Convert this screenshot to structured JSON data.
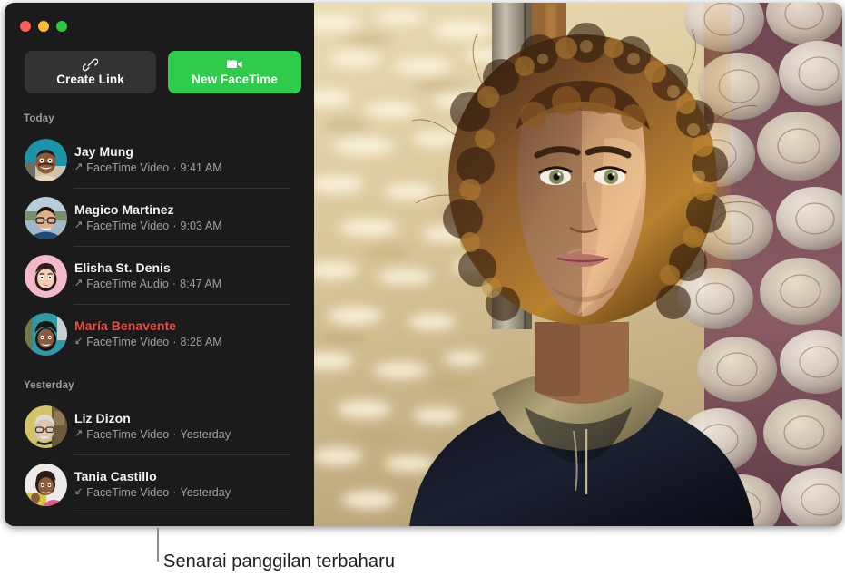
{
  "window": {
    "traffic_lights": [
      {
        "name": "close",
        "color": "#ff5f57"
      },
      {
        "name": "minimize",
        "color": "#febc2e"
      },
      {
        "name": "zoom",
        "color": "#28c840"
      }
    ]
  },
  "toolbar": {
    "create_link": {
      "label": "Create Link",
      "icon": "link-icon"
    },
    "new_facetime": {
      "label": "New FaceTime",
      "icon": "video-camera-icon",
      "color": "#2ecc4a"
    }
  },
  "sections": [
    {
      "title": "Today",
      "rows": [
        {
          "name": "Jay Mung",
          "direction": "outgoing",
          "arrow": "↗",
          "kind": "FaceTime Video",
          "separator": "·",
          "time": "9:41 AM",
          "missed": false,
          "avatar": "photo-man-teal"
        },
        {
          "name": "Magico Martinez",
          "direction": "outgoing",
          "arrow": "↗",
          "kind": "FaceTime Video",
          "separator": "·",
          "time": "9:03 AM",
          "missed": false,
          "avatar": "photo-man-glasses"
        },
        {
          "name": "Elisha St. Denis",
          "direction": "outgoing",
          "arrow": "↗",
          "kind": "FaceTime Audio",
          "separator": "·",
          "time": "8:47 AM",
          "missed": false,
          "avatar": "memoji-pink"
        },
        {
          "name": "María Benavente",
          "direction": "incoming",
          "arrow": "↙",
          "kind": "FaceTime Video",
          "separator": "·",
          "time": "8:28 AM",
          "missed": true,
          "avatar": "photo-woman-teal"
        }
      ]
    },
    {
      "title": "Yesterday",
      "rows": [
        {
          "name": "Liz Dizon",
          "direction": "outgoing",
          "arrow": "↗",
          "kind": "FaceTime Video",
          "separator": "·",
          "time": "Yesterday",
          "missed": false,
          "avatar": "photo-woman-yellow"
        },
        {
          "name": "Tania Castillo",
          "direction": "incoming",
          "arrow": "↙",
          "kind": "FaceTime Video",
          "separator": "·",
          "time": "Yesterday",
          "missed": false,
          "avatar": "photo-woman-white"
        }
      ]
    }
  ],
  "video": {
    "description": "FaceTime video of a person with curly hair in front of a sunlit wall with decorative plates"
  },
  "callout": {
    "text": "Senarai panggilan terbaharu"
  },
  "colors": {
    "accent_green": "#2ecc4a",
    "missed_red": "#f5483c",
    "sidebar_bg": "#1b1b1b"
  }
}
